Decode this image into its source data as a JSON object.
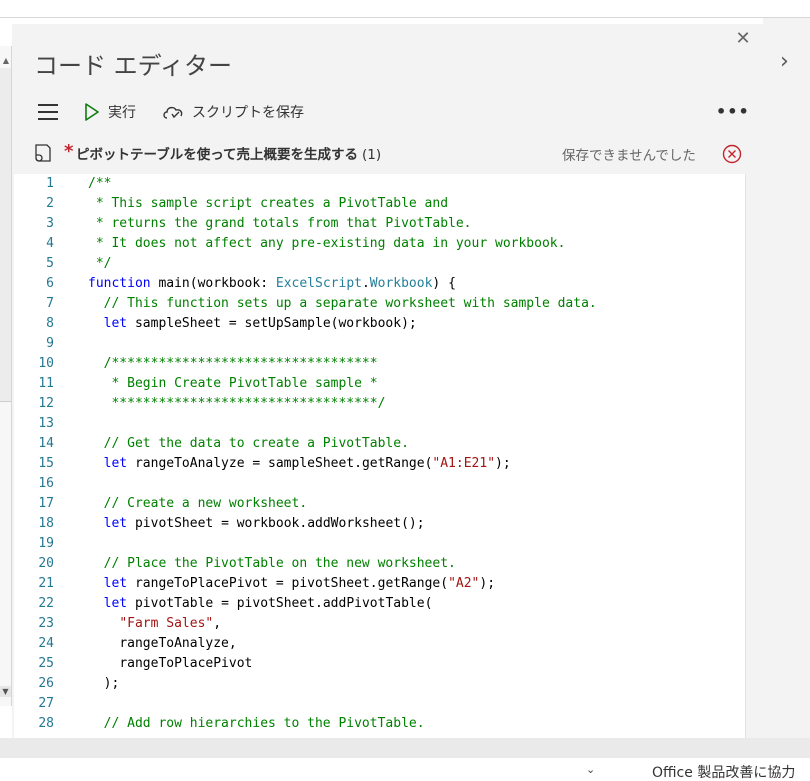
{
  "pane": {
    "title": "コード エディター",
    "toolbar": {
      "run_label": "実行",
      "save_label": "スクリプトを保存",
      "more_label": "•••"
    },
    "script": {
      "asterisk": "*",
      "name": "ピボットテーブルを使って売上概要を生成する",
      "count": "(1)"
    },
    "save_status": "保存できませんでした"
  },
  "editor": {
    "line_numbers": [
      "1",
      "2",
      "3",
      "4",
      "5",
      "6",
      "7",
      "8",
      "9",
      "10",
      "11",
      "12",
      "13",
      "14",
      "15",
      "16",
      "17",
      "18",
      "19",
      "20",
      "21",
      "22",
      "23",
      "24",
      "25",
      "26",
      "27",
      "28"
    ],
    "lines": [
      "/**",
      " * This sample script creates a PivotTable and",
      " * returns the grand totals from that PivotTable.",
      " * It does not affect any pre-existing data in your workbook.",
      " */",
      "function main(workbook: ExcelScript.Workbook) {",
      "  // This function sets up a separate worksheet with sample data.",
      "  let sampleSheet = setUpSample(workbook);",
      "",
      "  /**********************************",
      "   * Begin Create PivotTable sample *",
      "   **********************************/",
      "",
      "  // Get the data to create a PivotTable.",
      "  let rangeToAnalyze = sampleSheet.getRange(\"A1:E21\");",
      "",
      "  // Create a new worksheet.",
      "  let pivotSheet = workbook.addWorksheet();",
      "",
      "  // Place the PivotTable on the new worksheet.",
      "  let rangeToPlacePivot = pivotSheet.getRange(\"A2\");",
      "  let pivotTable = pivotSheet.addPivotTable(",
      "    \"Farm Sales\",",
      "    rangeToAnalyze,",
      "    rangeToPlacePivot",
      "  );",
      "",
      "  // Add row hierarchies to the PivotTable."
    ]
  },
  "status": {
    "feedback_link": "Office 製品改善に協力"
  },
  "colors": {
    "comment": "#008000",
    "keyword": "#0000ff",
    "string": "#a31515",
    "type": "#267f99",
    "line_number": "#237893",
    "error": "#c4262e"
  }
}
